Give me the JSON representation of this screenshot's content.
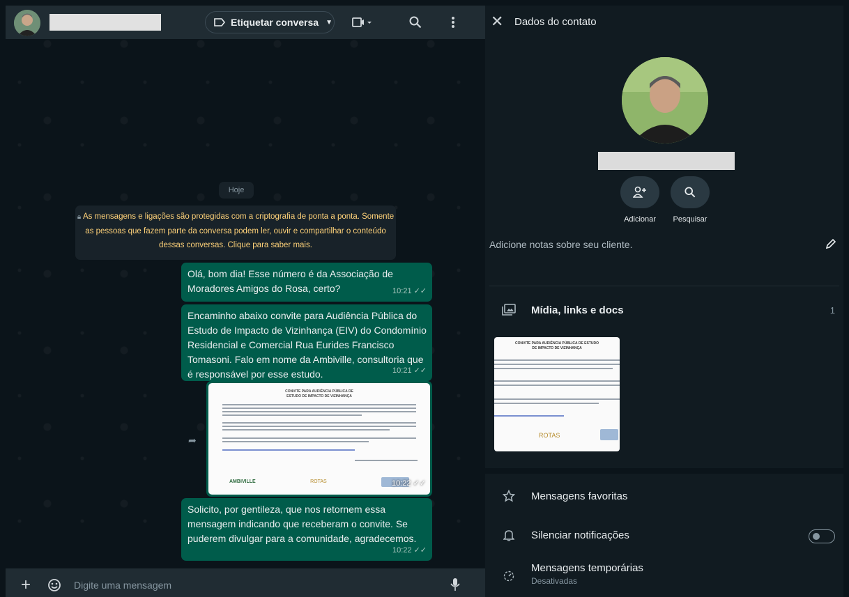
{
  "chat_header": {
    "label_button": "Etiquetar conversa"
  },
  "chat": {
    "date_chip": "Hoje",
    "encryption_notice": "As mensagens e ligações são protegidas com a criptografia de ponta a ponta. Somente as pessoas que fazem parte da conversa podem ler, ouvir e compartilhar o conteúdo dessas conversas. Clique para saber mais.",
    "messages": [
      {
        "text": "Olá, bom dia! Esse número é da Associação de Moradores Amigos do Rosa, certo?",
        "time": "10:21"
      },
      {
        "text": "Encaminho abaixo convite para Audiência Pública do Estudo de Impacto de Vizinhança (EIV) do Condomínio Residencial e Comercial Rua Eurides Francisco Tomasoni. Falo em nome da Ambiville, consultoria que é responsável por esse estudo.",
        "time": "10:21"
      },
      {
        "image_title": "CONVITE PARA AUDIÊNCIA PÚBLICA DE ESTUDO DE IMPACTO DE VIZINHANÇA",
        "logos": [
          "AMBIVILLE",
          "ROTAS"
        ],
        "time": "10:22"
      },
      {
        "text": "Solicito, por gentileza, que nos retornem essa mensagem indicando que receberam o convite. Se puderem divulgar para a comunidade, agradecemos.",
        "time": "10:22"
      }
    ]
  },
  "composer": {
    "placeholder": "Digite uma mensagem"
  },
  "contact_panel": {
    "title": "Dados do contato",
    "actions": [
      {
        "label": "Adicionar",
        "icon": "add-person-icon"
      },
      {
        "label": "Pesquisar",
        "icon": "search-icon"
      }
    ],
    "notes_placeholder": "Adicione notas sobre seu cliente.",
    "media_label": "Mídia, links e docs",
    "media_count": "1",
    "media_thumb_title": "CONVITE PARA AUDIÊNCIA PÚBLICA DE ESTUDO DE IMPACTO DE VIZINHANÇA",
    "media_thumb_logo": "ROTAS",
    "starred": "Mensagens favoritas",
    "mute": "Silenciar notificações",
    "disappearing": "Mensagens temporárias",
    "disappearing_status": "Desativadas"
  },
  "colors": {
    "outgoing_bubble": "#005c4b",
    "panel_bg": "#111b21",
    "header_bg": "#202c33",
    "notice_text": "#ffd279"
  }
}
